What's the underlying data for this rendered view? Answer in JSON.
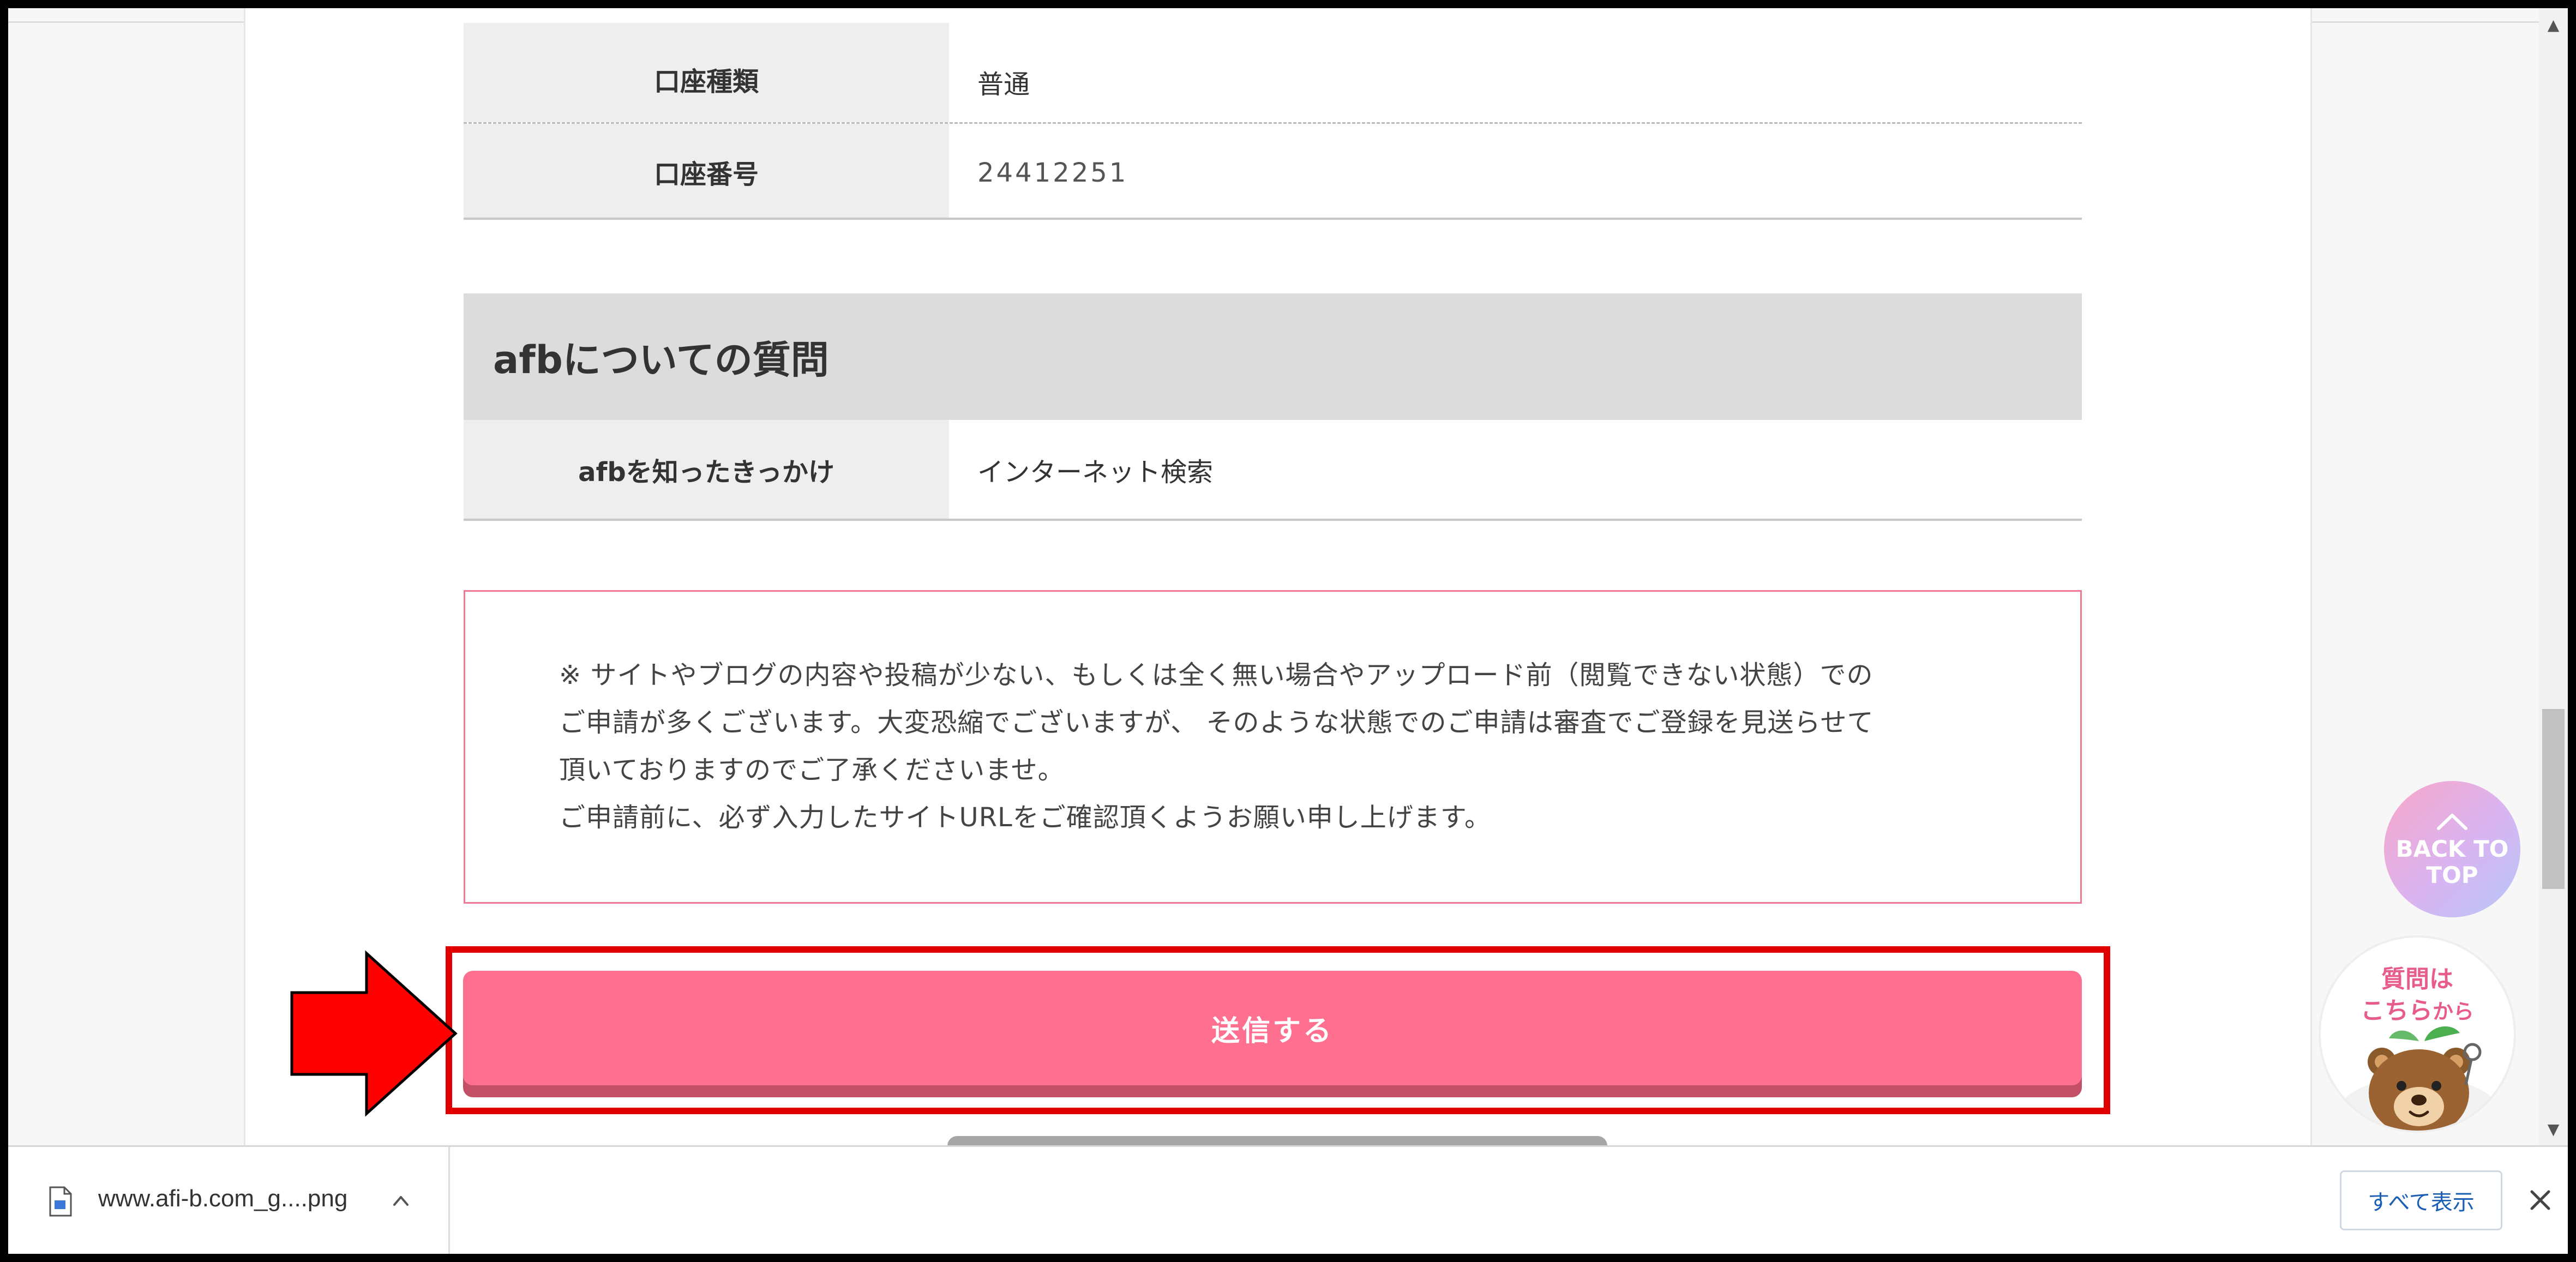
{
  "form": {
    "account_type": {
      "label": "口座種類",
      "value": "普通"
    },
    "account_number": {
      "label": "口座番号",
      "value": "24412251"
    },
    "section_title": "afbについての質問",
    "afb_source": {
      "label": "afbを知ったきっかけ",
      "value": "インターネット検索"
    }
  },
  "notice": {
    "lines": [
      "※ サイトやブログの内容や投稿が少ない、もしくは全く無い場合やアップロード前（閲覧できない状態）での",
      "ご申請が多くございます。大変恐縮でございますが、 そのような状態でのご申請は審査でご登録を見送らせて",
      "頂いておりますのでご了承くださいませ。",
      "ご申請前に、必ず入力したサイトURLをご確認頂くようお願い申し上げます。"
    ]
  },
  "submit": {
    "label": "送信する"
  },
  "back_to_top": {
    "line1": "BACK TO",
    "line2": "TOP",
    "icon": "chevron-up-icon"
  },
  "question_badge": {
    "line1": "質問は",
    "line2_a": "こちら",
    "line2_b": "から",
    "icon": "bear-mascot"
  },
  "download_bar": {
    "file_name": "www.afi-b.com_g....png",
    "show_all": "すべて表示"
  },
  "colors": {
    "submit": "#ff7090",
    "highlight": "#e00000",
    "arrow": "#ff0000",
    "notice_border": "#f07a96",
    "accent_pink": "#e85c8a"
  }
}
